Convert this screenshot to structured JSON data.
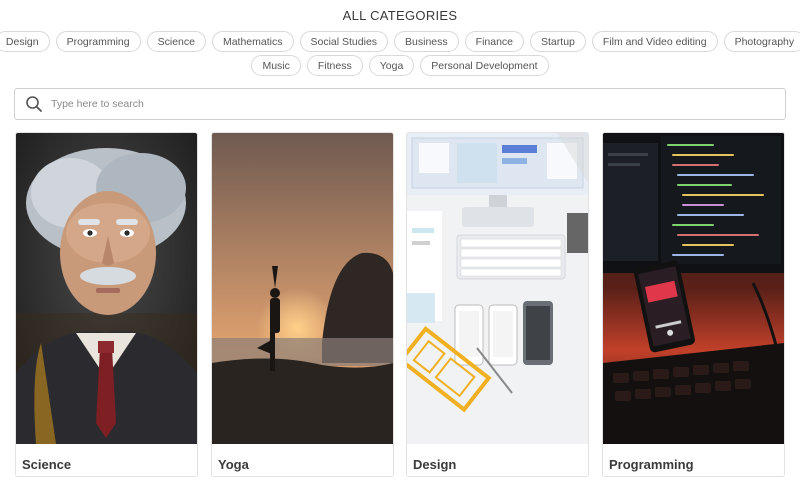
{
  "header": {
    "title": "ALL CATEGORIES"
  },
  "categories_row1": [
    "Design",
    "Programming",
    "Science",
    "Mathematics",
    "Social Studies",
    "Business",
    "Finance",
    "Startup",
    "Film and Video editing",
    "Photography"
  ],
  "categories_row2": [
    "Music",
    "Fitness",
    "Yoga",
    "Personal Development"
  ],
  "search": {
    "placeholder": "Type here to search",
    "icon": "search-icon"
  },
  "cards": [
    {
      "label": "Science",
      "image": "einstein-figurine"
    },
    {
      "label": "Yoga",
      "image": "yoga-silhouette-sunset"
    },
    {
      "label": "Design",
      "image": "designer-desk-flatlay"
    },
    {
      "label": "Programming",
      "image": "code-monitor-phone"
    }
  ],
  "colors": {
    "border": "#d9d9d9",
    "text": "#3a3a3a",
    "chip_text": "#555555"
  }
}
